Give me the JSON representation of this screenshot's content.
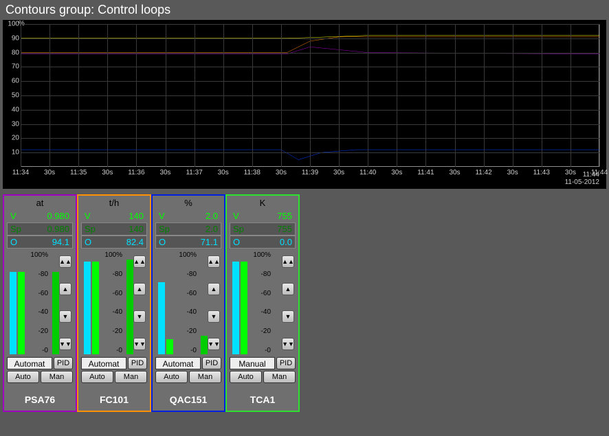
{
  "title": "Contours group: Control loops",
  "chart_data": {
    "type": "line",
    "title": "",
    "ylabel": "",
    "yunit": "%",
    "ylim": [
      0,
      100
    ],
    "yticks": [
      10,
      20,
      30,
      40,
      50,
      60,
      70,
      80,
      90,
      100
    ],
    "x_ticks": [
      "11:34",
      "30s",
      "11:35",
      "30s",
      "11:36",
      "30s",
      "11:37",
      "30s",
      "11:38",
      "30s",
      "11:39",
      "30s",
      "11:40",
      "30s",
      "11:41",
      "30s",
      "11:42",
      "30s",
      "11:43",
      "30s",
      "11:44"
    ],
    "x_end_label": "11:44",
    "date": "11-05-2012",
    "series": [
      {
        "name": "PSA76",
        "color": "#ff8000",
        "points": [
          [
            0,
            80
          ],
          [
            46,
            80
          ],
          [
            50,
            88
          ],
          [
            55,
            91
          ],
          [
            100,
            91
          ]
        ]
      },
      {
        "name": "FC101",
        "color": "#ffff00",
        "points": [
          [
            0,
            90
          ],
          [
            46,
            90
          ],
          [
            50,
            90.5
          ],
          [
            60,
            92
          ],
          [
            100,
            92
          ]
        ]
      },
      {
        "name": "QAC151",
        "color": "#a000c0",
        "points": [
          [
            0,
            79
          ],
          [
            46,
            79
          ],
          [
            50,
            84
          ],
          [
            55,
            82
          ],
          [
            60,
            80
          ],
          [
            100,
            79
          ]
        ]
      },
      {
        "name": "TCA1",
        "color": "#0040ff",
        "points": [
          [
            0,
            12
          ],
          [
            45,
            12
          ],
          [
            48,
            5
          ],
          [
            52,
            10
          ],
          [
            58,
            12
          ],
          [
            100,
            12
          ]
        ]
      }
    ]
  },
  "faceplates": [
    {
      "border": "#a000c0",
      "unit": "at",
      "tag": "PSA76",
      "pv": "0.980",
      "sp": "0.980",
      "op": "94.1",
      "mode": "Automat",
      "bars": {
        "pv": 80,
        "sp": 80,
        "op": 80
      }
    },
    {
      "border": "#ff9000",
      "unit": "t/h",
      "tag": "FC101",
      "pv": "140",
      "sp": "140",
      "op": "82.4",
      "mode": "Automat",
      "bars": {
        "pv": 90,
        "sp": 90,
        "op": 92
      }
    },
    {
      "border": "#0020e0",
      "unit": "%",
      "tag": "QAC151",
      "pv": "2.0",
      "sp": "2.0",
      "op": "71.1",
      "mode": "Automat",
      "bars": {
        "pv": 70,
        "sp": 15,
        "op": 18
      }
    },
    {
      "border": "#30e030",
      "unit": "K",
      "tag": "TCA1",
      "pv": "755",
      "sp": "755",
      "op": "0.0",
      "mode": "Manual",
      "bars": {
        "pv": 90,
        "sp": 90,
        "op": 0
      }
    }
  ],
  "labels": {
    "V": "V",
    "Sp": "Sp",
    "O": "O",
    "scale_top": "100%",
    "scale_ticks": [
      "80",
      "60",
      "40",
      "20",
      "0"
    ],
    "pid": "PID",
    "auto": "Auto",
    "man": "Man"
  }
}
